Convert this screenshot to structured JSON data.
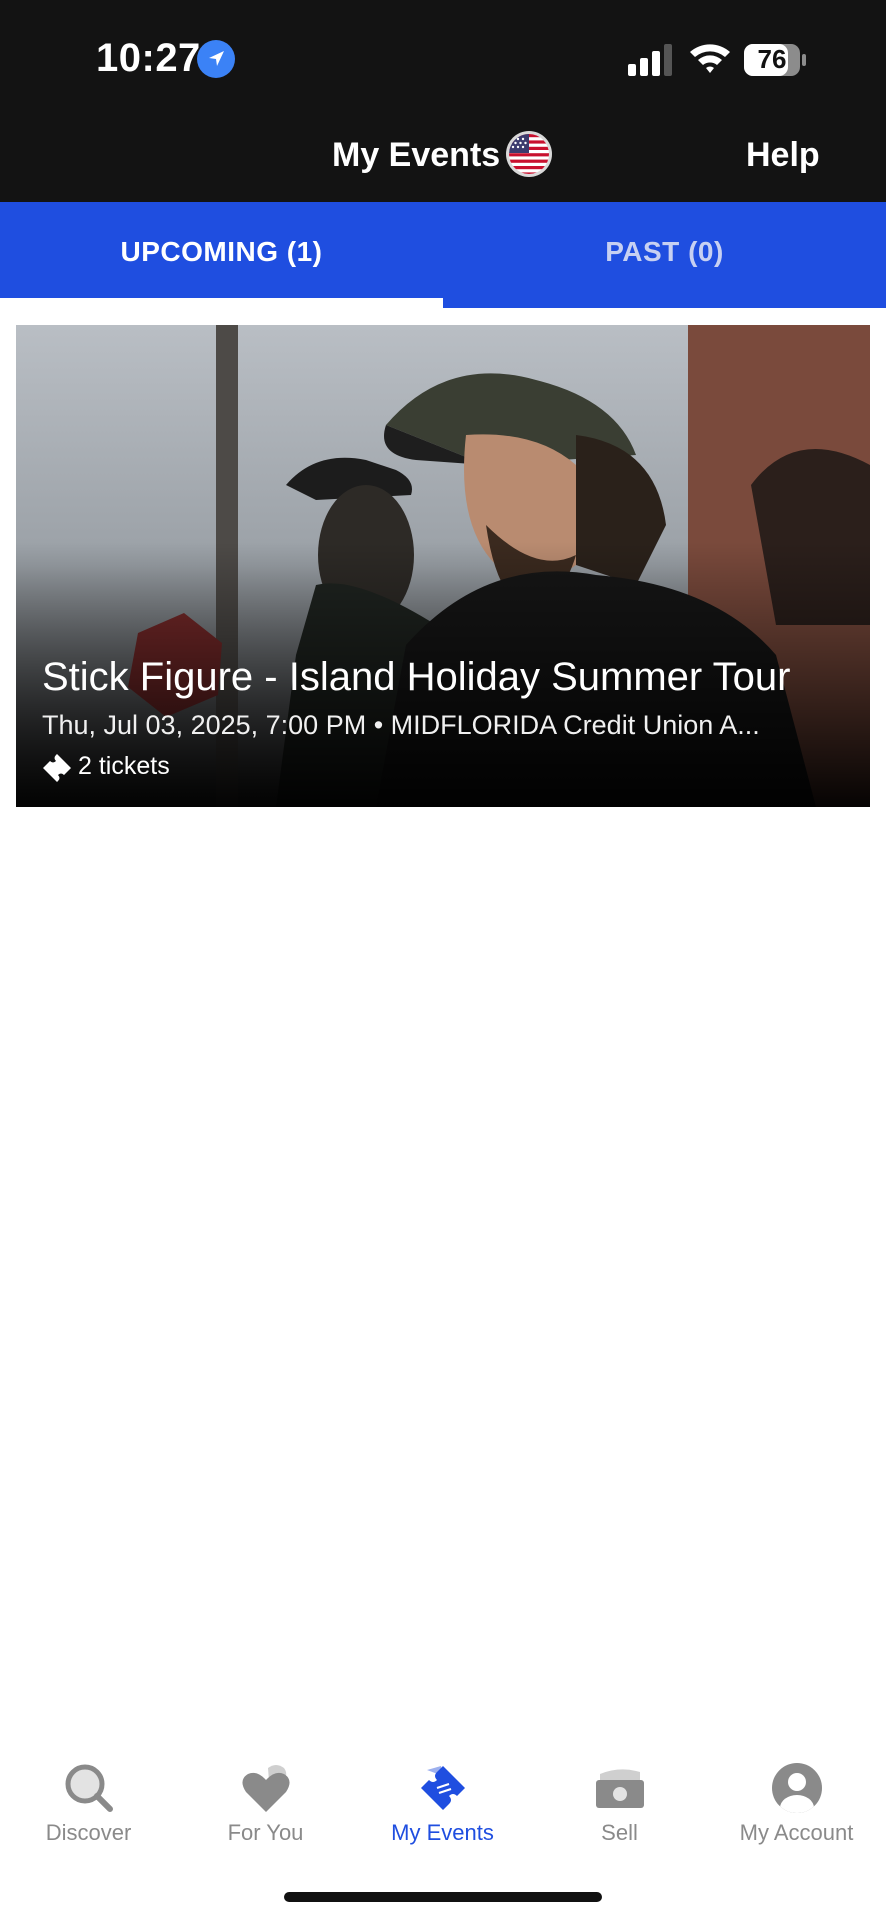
{
  "status": {
    "time": "10:27",
    "battery": "76"
  },
  "header": {
    "title": "My Events",
    "help_label": "Help"
  },
  "tabs": [
    {
      "label": "UPCOMING (1)",
      "active": true
    },
    {
      "label": "PAST (0)",
      "active": false
    }
  ],
  "events": [
    {
      "title": "Stick Figure - Island Holiday Summer Tour",
      "meta": "Thu, Jul 03, 2025, 7:00 PM • MIDFLORIDA Credit Union A...",
      "tickets": "2 tickets"
    }
  ],
  "nav": [
    {
      "label": "Discover",
      "icon": "search-icon"
    },
    {
      "label": "For You",
      "icon": "heart-icon"
    },
    {
      "label": "My Events",
      "icon": "ticket-icon",
      "active": true
    },
    {
      "label": "Sell",
      "icon": "cash-icon"
    },
    {
      "label": "My Account",
      "icon": "person-icon"
    }
  ],
  "colors": {
    "brand_blue": "#1f4ee0",
    "header_bg": "#131313",
    "inactive_nav": "#8a8a8a"
  }
}
